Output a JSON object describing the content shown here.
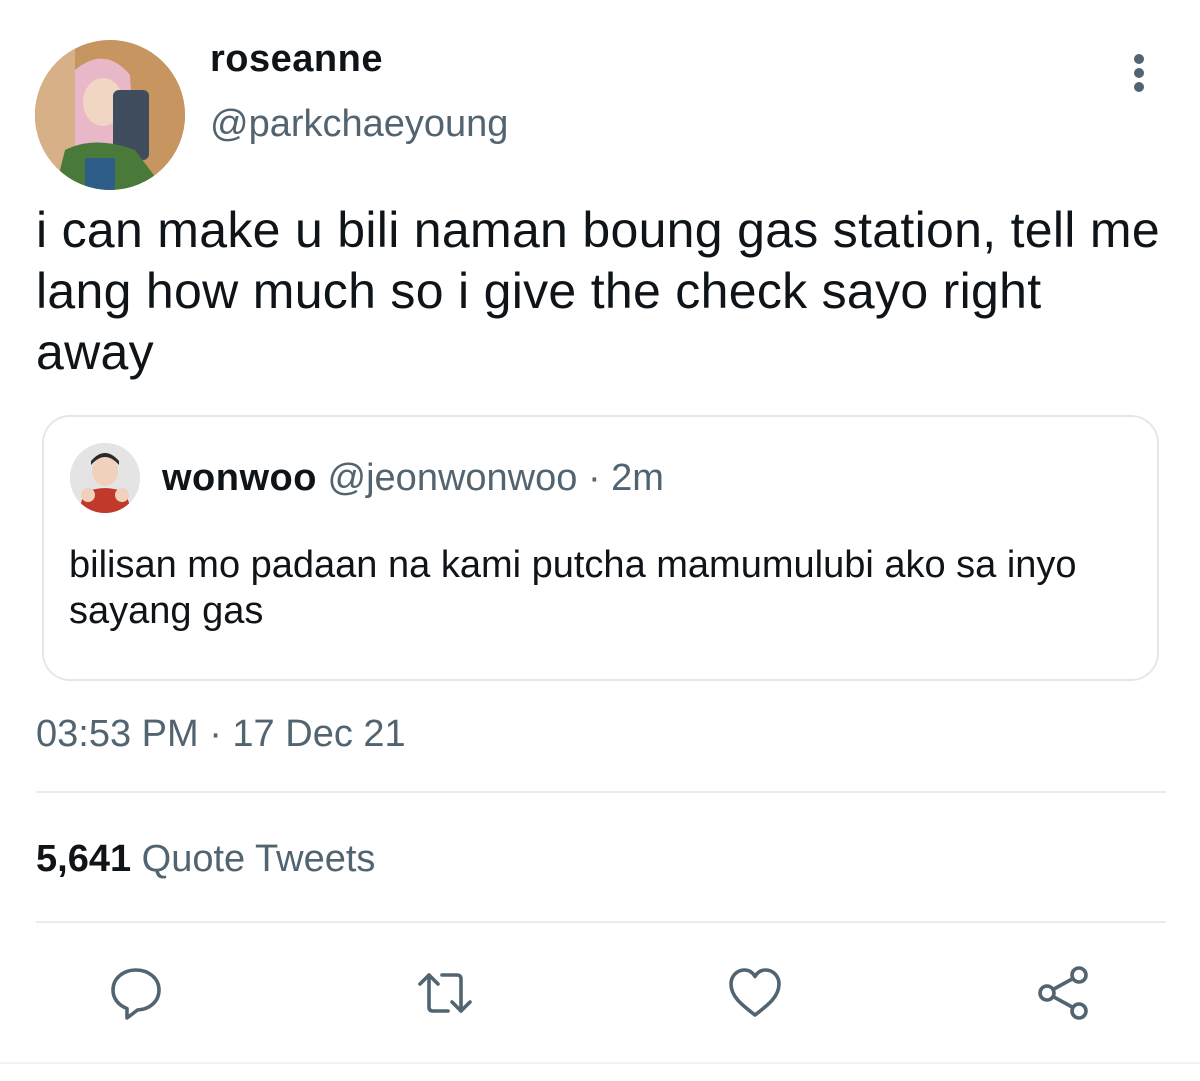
{
  "author": {
    "display_name": "roseanne",
    "handle": "@parkchaeyoung"
  },
  "tweet": {
    "text": "i can make u bili naman boung gas station, tell me lang how much so i give the check sayo right away",
    "timestamp": "03:53 PM · 17 Dec 21"
  },
  "quoted_tweet": {
    "display_name": "wonwoo",
    "handle": "@jeonwonwoo",
    "separator": "·",
    "time": "2m",
    "text": "bilisan mo padaan na kami putcha mamumulubi ako sa inyo sayang gas"
  },
  "stats": {
    "quote_tweets_count": "5,641",
    "quote_tweets_label": "Quote Tweets"
  },
  "actions": [
    {
      "icon": "reply-icon"
    },
    {
      "icon": "retweet-icon"
    },
    {
      "icon": "like-icon"
    },
    {
      "icon": "share-icon"
    }
  ],
  "colors": {
    "text_primary": "#0f1419",
    "text_secondary": "#536471",
    "border": "#e1e8ed",
    "background": "#ffffff"
  }
}
